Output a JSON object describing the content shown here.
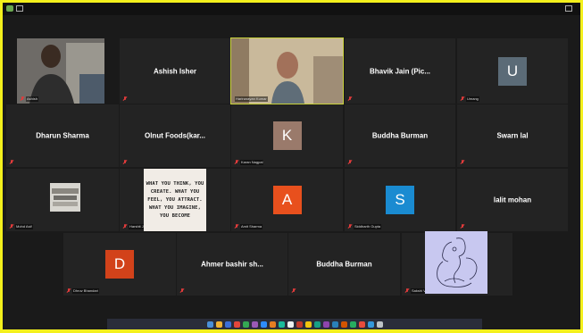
{
  "participants": {
    "ashish": {
      "label": "Ashish"
    },
    "ashish_isher": {
      "name": "Ashish Isher"
    },
    "harinarayan": {
      "label": "Harinarayan Kumar"
    },
    "bhavik": {
      "name": "Bhavik Jain (Pic..."
    },
    "umang": {
      "initial": "U",
      "label": "Umang",
      "color": "#5b6b77"
    },
    "dharun": {
      "name": "Dharun Sharma"
    },
    "olnut": {
      "name": "Olnut Foods(kar..."
    },
    "karan": {
      "initial": "K",
      "label": "Karan Nagpal",
      "color": "#9a7a6b"
    },
    "buddha1": {
      "name": "Buddha Burman"
    },
    "swarn": {
      "name": "Swarn lal"
    },
    "mohd": {
      "label": "Mohd Asif"
    },
    "harshit": {
      "label": "Harshit Jain"
    },
    "amit": {
      "initial": "A",
      "label": "Amit Sharma",
      "color": "#e8501d"
    },
    "siddharth": {
      "initial": "S",
      "label": "Siddharth Gupta",
      "color": "#1a8bd1"
    },
    "lalit": {
      "name": "lalit mohan"
    },
    "dhruv": {
      "initial": "D",
      "label": "Dhruv Bhandari",
      "color": "#d2421a"
    },
    "ahmer": {
      "name": "Ahmer bashir sh..."
    },
    "buddha2": {
      "name": "Buddha Burman"
    },
    "sakshi": {
      "label": "Sakshi Verma"
    }
  },
  "quote": {
    "lines": [
      "WHAT YOU THINK, YOU",
      "CREATE. WHAT YOU",
      "FEEL, YOU ATTRACT.",
      "WHAT YOU IMAGINE,",
      "YOU BECOME"
    ]
  },
  "colors": {
    "active_border": "#c9d23a",
    "muted_mic": "#e23b3b",
    "tile_bg": "#232323",
    "frame_bg": "#1a1a1a"
  }
}
